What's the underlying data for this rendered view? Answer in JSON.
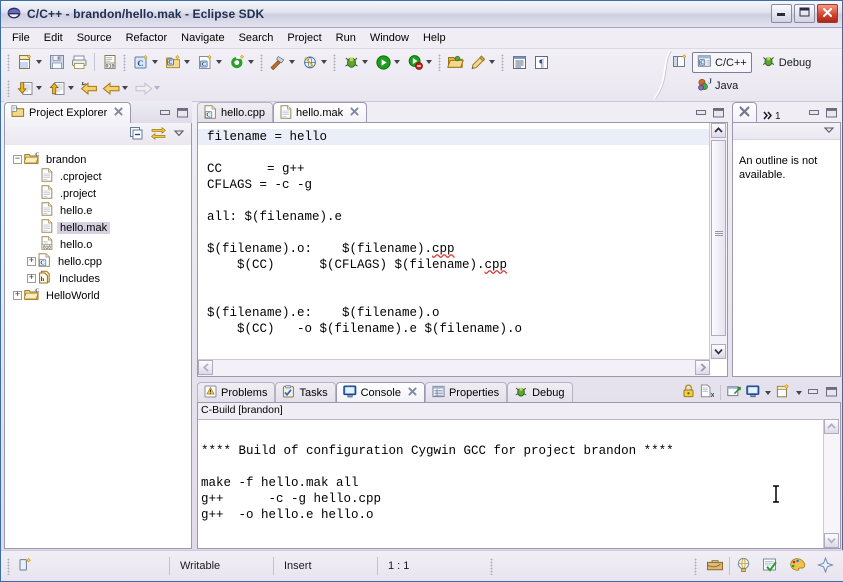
{
  "window": {
    "title": "C/C++ - brandon/hello.mak - Eclipse SDK",
    "app_icon": "eclipse-icon",
    "controls": {
      "minimize": "minimize-button",
      "maximize": "maximize-button",
      "close": "close-button"
    }
  },
  "menubar": {
    "items": [
      "File",
      "Edit",
      "Source",
      "Refactor",
      "Navigate",
      "Search",
      "Project",
      "Run",
      "Window",
      "Help"
    ]
  },
  "toolbar": {
    "row1": [
      {
        "name": "new-file-button",
        "icon": "new-file-icon",
        "dropdown": true
      },
      {
        "name": "save-button",
        "icon": "save-icon",
        "dropdown": false
      },
      {
        "name": "print-button",
        "icon": "print-icon",
        "dropdown": false
      },
      {
        "name": "binary-file-button",
        "icon": "binary-010-icon",
        "dropdown": false
      },
      {
        "name": "new-c-project-button",
        "icon": "c-project-icon",
        "dropdown": true
      },
      {
        "name": "new-c-folder-button",
        "icon": "c-folder-icon",
        "dropdown": true
      },
      {
        "name": "new-c-class-button",
        "icon": "c-class-icon",
        "dropdown": true
      },
      {
        "name": "refresh-button",
        "icon": "green-refresh-icon",
        "dropdown": true
      },
      {
        "name": "build-button",
        "icon": "hammer-icon",
        "dropdown": true
      },
      {
        "name": "search-button",
        "icon": "search-globe-icon",
        "dropdown": true
      },
      {
        "name": "debug-button",
        "icon": "debug-bug-icon",
        "dropdown": true
      },
      {
        "name": "run-button",
        "icon": "run-play-icon",
        "dropdown": true
      },
      {
        "name": "external-tools-button",
        "icon": "external-tools-icon",
        "dropdown": true
      },
      {
        "name": "open-resource-button",
        "icon": "open-folder-icon",
        "dropdown": false
      },
      {
        "name": "marker-button",
        "icon": "pencil-marker-icon",
        "dropdown": true
      },
      {
        "name": "show-whitespace-button",
        "icon": "whitespace-icon",
        "dropdown": false
      },
      {
        "name": "paragraph-button",
        "icon": "pilcrow-icon",
        "dropdown": false
      }
    ],
    "row2": [
      {
        "name": "next-annotation-button",
        "icon": "down-arrow-doc-icon",
        "dropdown": true
      },
      {
        "name": "previous-annotation-button",
        "icon": "up-arrow-doc-icon",
        "dropdown": true
      },
      {
        "name": "last-edit-location-button",
        "icon": "back-star-arrow-icon",
        "dropdown": false
      },
      {
        "name": "back-button",
        "icon": "back-arrow-icon",
        "dropdown": true
      },
      {
        "name": "forward-button",
        "icon": "forward-arrow-icon",
        "dropdown": true
      }
    ]
  },
  "perspectives": {
    "open_perspective": "open-perspective-icon",
    "items": [
      {
        "label": "C/C++",
        "icon": "cpp-perspective-icon",
        "active": true
      },
      {
        "label": "Debug",
        "icon": "debug-perspective-icon",
        "active": false
      },
      {
        "label": "Java",
        "icon": "java-perspective-icon",
        "active": false
      }
    ]
  },
  "project_explorer": {
    "tab_label": "Project Explorer",
    "tab_icon": "project-explorer-icon",
    "toolbar": [
      {
        "name": "collapse-all-button",
        "icon": "collapse-all-icon"
      },
      {
        "name": "link-with-editor-button",
        "icon": "link-editor-icon"
      },
      {
        "name": "view-menu-button",
        "icon": "chevron-down-icon"
      }
    ],
    "panel_buttons": [
      {
        "name": "minimize-view-button",
        "icon": "minimize-icon"
      },
      {
        "name": "maximize-view-button",
        "icon": "maximize-icon"
      }
    ],
    "tree": [
      {
        "label": "brandon",
        "icon": "c-project-folder-icon",
        "indent": 0,
        "expander": "minus",
        "selected": false
      },
      {
        "label": ".cproject",
        "icon": "file-icon",
        "indent": 1,
        "expander": "none",
        "selected": false
      },
      {
        "label": ".project",
        "icon": "file-icon",
        "indent": 1,
        "expander": "none",
        "selected": false
      },
      {
        "label": "hello.e",
        "icon": "file-icon",
        "indent": 1,
        "expander": "none",
        "selected": false
      },
      {
        "label": "hello.mak",
        "icon": "file-icon",
        "indent": 1,
        "expander": "none",
        "selected": true
      },
      {
        "label": "hello.o",
        "icon": "binary-010-icon",
        "indent": 1,
        "expander": "none",
        "selected": false
      },
      {
        "label": "hello.cpp",
        "icon": "cpp-source-icon",
        "indent": 1,
        "expander": "plus",
        "selected": false
      },
      {
        "label": "Includes",
        "icon": "includes-icon",
        "indent": 1,
        "expander": "plus",
        "selected": false
      },
      {
        "label": "HelloWorld",
        "icon": "c-project-folder-icon",
        "indent": 0,
        "expander": "plus",
        "selected": false
      }
    ]
  },
  "editor": {
    "tabs": [
      {
        "label": "hello.cpp",
        "icon": "cpp-source-icon",
        "active": false,
        "closable": false
      },
      {
        "label": "hello.mak",
        "icon": "file-icon",
        "active": true,
        "closable": true
      }
    ],
    "panel_buttons": [
      {
        "name": "minimize-editor-button",
        "icon": "minimize-icon"
      },
      {
        "name": "maximize-editor-button",
        "icon": "maximize-icon"
      }
    ],
    "lines": [
      "filename = hello",
      "",
      "CC      = g++",
      "CFLAGS = -c -g",
      "",
      "all: $(filename).e",
      "",
      "$(filename).o:    $(filename).cpp",
      "    $(CC)      $(CFLAGS) $(filename).cpp",
      "",
      "",
      "$(filename).e:    $(filename).o",
      "    $(CC)   -o $(filename).e $(filename).o"
    ],
    "current_line_index": 0,
    "misspelled_word": "cpp"
  },
  "outline": {
    "tab_icon": "close-x-icon",
    "overflow_label": "1",
    "message": "An outline is not available.",
    "panel_buttons": [
      {
        "name": "minimize-outline-button",
        "icon": "minimize-icon"
      },
      {
        "name": "maximize-outline-button",
        "icon": "maximize-icon"
      }
    ],
    "view_menu": "chevron-down-icon"
  },
  "console_panel": {
    "tabs": [
      {
        "label": "Problems",
        "icon": "problems-icon",
        "active": false,
        "closable": false
      },
      {
        "label": "Tasks",
        "icon": "tasks-icon",
        "active": false,
        "closable": false
      },
      {
        "label": "Console",
        "icon": "console-icon",
        "active": true,
        "closable": true
      },
      {
        "label": "Properties",
        "icon": "properties-icon",
        "active": false,
        "closable": false
      },
      {
        "label": "Debug",
        "icon": "debug-bug-icon",
        "active": false,
        "closable": false
      }
    ],
    "toolbar": [
      {
        "name": "scroll-lock-button",
        "icon": "lock-icon"
      },
      {
        "name": "clear-console-button",
        "icon": "clear-console-icon"
      },
      {
        "name": "pin-console-button",
        "icon": "pin-console-icon"
      },
      {
        "name": "display-console-button",
        "icon": "display-console-icon",
        "dropdown": true
      },
      {
        "name": "open-console-button",
        "icon": "new-console-icon",
        "dropdown": true
      }
    ],
    "panel_buttons": [
      {
        "name": "minimize-console-button",
        "icon": "minimize-icon"
      },
      {
        "name": "maximize-console-button",
        "icon": "maximize-icon"
      }
    ],
    "title": "C-Build [brandon]",
    "lines": [
      "",
      "**** Build of configuration Cygwin GCC for project brandon ****",
      "",
      "make -f hello.mak all",
      "g++      -c -g hello.cpp",
      "g++  -o hello.e hello.o"
    ]
  },
  "status_bar": {
    "left_icon": "editor-state-icon",
    "writable": "Writable",
    "insert_mode": "Insert",
    "position": "1 : 1",
    "right_icons": [
      {
        "name": "briefcase-icon"
      },
      {
        "name": "globe-icon"
      },
      {
        "name": "checked-document-icon"
      },
      {
        "name": "palette-icon"
      },
      {
        "name": "diamond-icon"
      }
    ]
  },
  "colors": {
    "accent": "#3b6ea5",
    "selection": "#d6d2e2",
    "current_line": "#eaeef8",
    "spell_error": "#dd3333",
    "chrome": "#ece9d8"
  }
}
